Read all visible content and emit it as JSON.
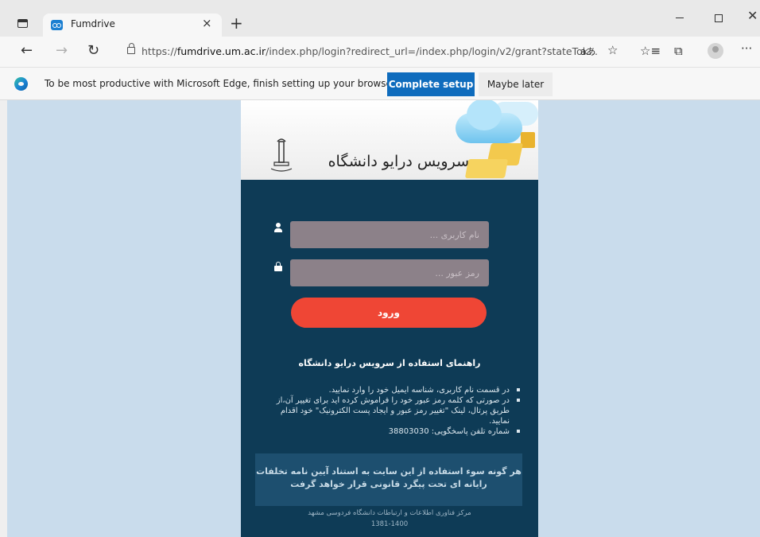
{
  "browser": {
    "tab_title": "Fumdrive",
    "tab_close": "×",
    "new_tab": "+",
    "address": {
      "scheme": "https://",
      "host": "fumdrive.um.ac.ir",
      "path": "/index.php/login?redirect_url=/index.php/login/v2/grant?stateTok...",
      "read_aloud": "aあ"
    },
    "window_controls": {
      "close": "✕"
    },
    "nav": {
      "back": "←",
      "forward": "→",
      "refresh": "↻",
      "more": "···"
    }
  },
  "infobar": {
    "message": "To be most productive with Microsoft Edge, finish setting up your browser.",
    "primary_button": "Complete setup",
    "secondary_button": "Maybe later"
  },
  "banner": {
    "title": "سرویس درایو دانشگاه"
  },
  "login": {
    "username_placeholder": "نام کاربری ...",
    "password_placeholder": "رمز عبور ...",
    "submit_label": "ورود"
  },
  "guide": {
    "title": "راهنمای استفاده از سرویس درایو دانشگاه",
    "items": [
      "در قسمت نام کاربری، شناسه ایمیل خود را وارد نمایید.",
      "در صورتی که کلمه رمز عبور خود را فراموش کرده اید برای تغییر آن،از طریق پرتال، لینک \"تغییر رمز عبور و ایجاد پست الکترونیک\" خود اقدام نمایید.",
      "شماره تلفن پاسخگویی: 38803030"
    ]
  },
  "warning": {
    "text": "هر گونه سوء استفاده از این سایت به استناد آیین نامه تخلفات رایانه ای تحت پیگرد قانونی قرار خواهد گرفت"
  },
  "footer": {
    "org": "مرکز فناوری اطلاعات و ارتباطات دانشگاه فردوسی مشهد",
    "years": "1381-1400"
  },
  "colors": {
    "page_bg": "#c9dcec",
    "panel_bg": "#0e3b56",
    "login_button": "#ef4635",
    "input_bg": "#8c8189",
    "edge_primary": "#0f6cbd"
  }
}
